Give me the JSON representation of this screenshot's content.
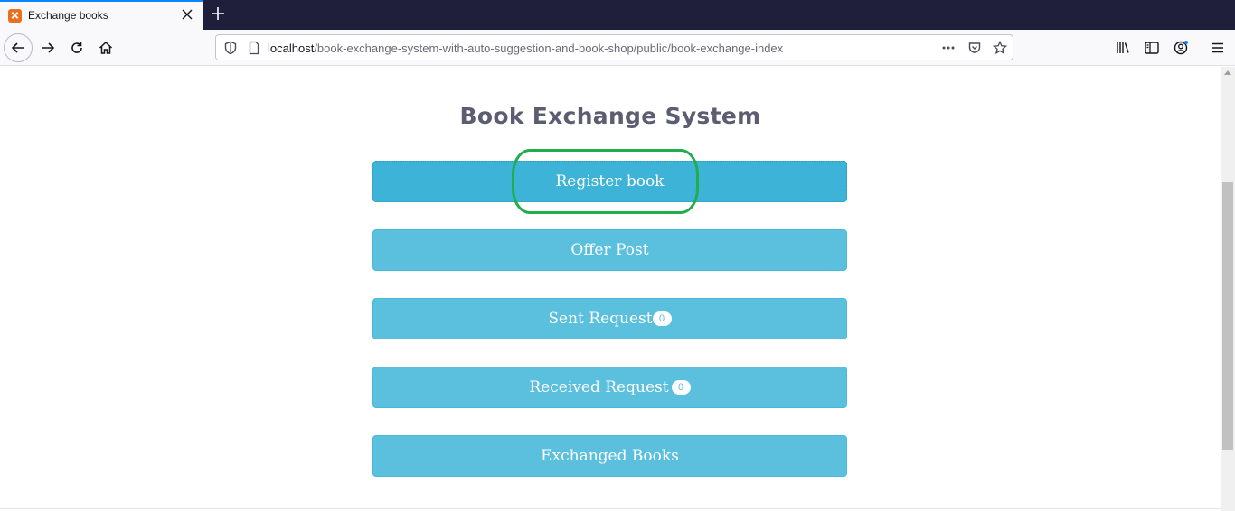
{
  "browser": {
    "tab": {
      "title": "Exchange books",
      "favicon": "xampp-favicon-icon"
    },
    "url": {
      "host": "localhost",
      "path": "/book-exchange-system-with-auto-suggestion-and-book-shop/public/book-exchange-index"
    }
  },
  "page": {
    "title": "Book Exchange System",
    "buttons": [
      {
        "label": "Register book",
        "badge": null,
        "active": true
      },
      {
        "label": "Offer Post",
        "badge": null,
        "active": false
      },
      {
        "label": "Sent Request",
        "badge": "0",
        "active": false
      },
      {
        "label": "Received Request",
        "badge": "0",
        "active": false
      },
      {
        "label": "Exchanged Books",
        "badge": null,
        "active": false
      }
    ],
    "annotation": {
      "color": "#22ad4c",
      "target": "Register book"
    }
  },
  "colors": {
    "button": "#5bc0de",
    "button_active": "#3db3d7",
    "title": "#5b5d70",
    "tab_accent": "#0a84ff"
  }
}
